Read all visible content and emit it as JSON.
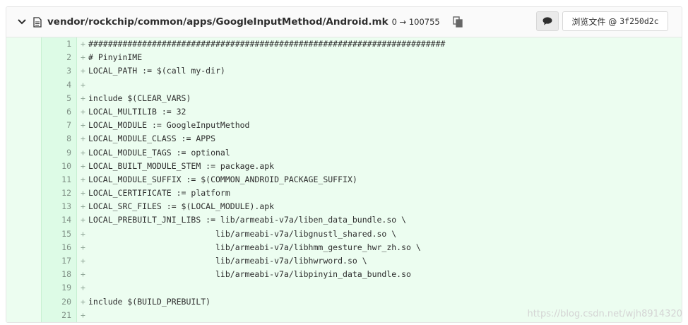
{
  "file_header": {
    "path": "vendor/rockchip/common/apps/GoogleInputMethod/Android.mk",
    "mode_change": "0 → 100755",
    "view_file_label": "浏览文件 @",
    "commit_sha": "3f250d2c"
  },
  "icons": {
    "collapse": "chevron-down-icon",
    "file": "file-icon",
    "copy": "copy-icon",
    "comment": "comment-icon"
  },
  "diff": {
    "prefix": "+",
    "lines": [
      {
        "num": "1",
        "text": "#########################################################################"
      },
      {
        "num": "2",
        "text": "# PinyinIME"
      },
      {
        "num": "3",
        "text": "LOCAL_PATH := $(call my-dir)"
      },
      {
        "num": "4",
        "text": ""
      },
      {
        "num": "5",
        "text": "include $(CLEAR_VARS)"
      },
      {
        "num": "6",
        "text": "LOCAL_MULTILIB := 32"
      },
      {
        "num": "7",
        "text": "LOCAL_MODULE := GoogleInputMethod"
      },
      {
        "num": "8",
        "text": "LOCAL_MODULE_CLASS := APPS"
      },
      {
        "num": "9",
        "text": "LOCAL_MODULE_TAGS := optional"
      },
      {
        "num": "10",
        "text": "LOCAL_BUILT_MODULE_STEM := package.apk"
      },
      {
        "num": "11",
        "text": "LOCAL_MODULE_SUFFIX := $(COMMON_ANDROID_PACKAGE_SUFFIX)"
      },
      {
        "num": "12",
        "text": "LOCAL_CERTIFICATE := platform"
      },
      {
        "num": "13",
        "text": "LOCAL_SRC_FILES := $(LOCAL_MODULE).apk"
      },
      {
        "num": "14",
        "text": "LOCAL_PREBUILT_JNI_LIBS := lib/armeabi-v7a/liben_data_bundle.so \\"
      },
      {
        "num": "15",
        "text": "                          lib/armeabi-v7a/libgnustl_shared.so \\"
      },
      {
        "num": "16",
        "text": "                          lib/armeabi-v7a/libhmm_gesture_hwr_zh.so \\"
      },
      {
        "num": "17",
        "text": "                          lib/armeabi-v7a/libhwrword.so \\"
      },
      {
        "num": "18",
        "text": "                          lib/armeabi-v7a/libpinyin_data_bundle.so"
      },
      {
        "num": "19",
        "text": ""
      },
      {
        "num": "20",
        "text": "include $(BUILD_PREBUILT)"
      },
      {
        "num": "21",
        "text": ""
      }
    ]
  },
  "watermark": "https://blog.csdn.net/wjh8914320",
  "colors": {
    "added_line_bg": "#ecfdf0",
    "added_number_bg": "#ddfbe6",
    "header_bg": "#fafafa"
  }
}
